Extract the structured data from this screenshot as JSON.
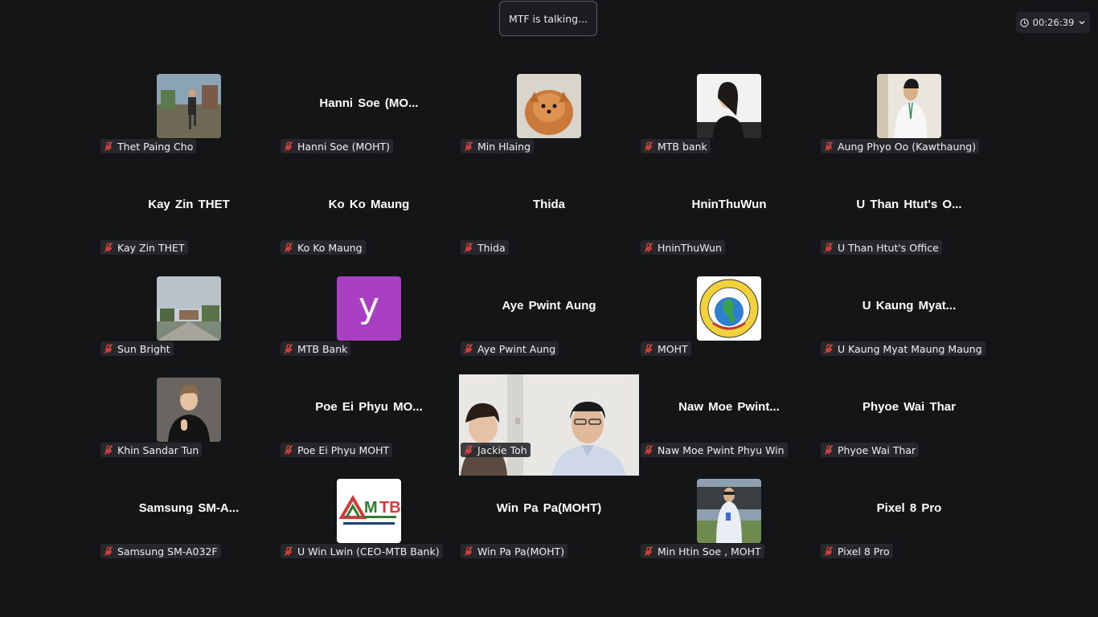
{
  "talking_indicator": "MTF is talking...",
  "timer": "00:26:39",
  "colors": {
    "background": "#141517",
    "mic_muted": "#e2453c"
  },
  "participants": [
    {
      "name": "Thet Paing Cho",
      "display": "photo",
      "icon": "person-photo"
    },
    {
      "name": "Hanni Soe (MOHT)",
      "display": "name",
      "big_name": "Hanni Soe (MO..."
    },
    {
      "name": "Min Hlaing",
      "display": "photo",
      "icon": "dog-photo"
    },
    {
      "name": "MTB bank",
      "display": "photo",
      "icon": "person-photo"
    },
    {
      "name": "Aung Phyo Oo (Kawthaung)",
      "display": "photo",
      "icon": "person-photo"
    },
    {
      "name": "Kay Zin THET",
      "display": "name",
      "big_name": "Kay Zin THET"
    },
    {
      "name": "Ko Ko Maung",
      "display": "name",
      "big_name": "Ko Ko Maung"
    },
    {
      "name": "Thida",
      "display": "name",
      "big_name": "Thida"
    },
    {
      "name": "HninThuWun",
      "display": "name",
      "big_name": "HninThuWun"
    },
    {
      "name": "U Than Htut's Office",
      "display": "name",
      "big_name": "U Than Htut's O..."
    },
    {
      "name": "Sun Bright",
      "display": "photo",
      "icon": "landscape-photo"
    },
    {
      "name": "MTB Bank",
      "display": "letter",
      "letter": "y",
      "color": "#a93fc1"
    },
    {
      "name": "Aye Pwint Aung",
      "display": "name",
      "big_name": "Aye Pwint Aung"
    },
    {
      "name": "MOHT",
      "display": "photo",
      "icon": "ministry-logo"
    },
    {
      "name": "U Kaung Myat Maung Maung",
      "display": "name",
      "big_name": "U Kaung Myat..."
    },
    {
      "name": "Khin Sandar Tun",
      "display": "photo",
      "icon": "person-photo"
    },
    {
      "name": "Poe Ei Phyu MOHT",
      "display": "name",
      "big_name": "Poe Ei Phyu MO..."
    },
    {
      "name": "Jackie Toh",
      "display": "video",
      "icon": "video-feed"
    },
    {
      "name": "Naw Moe Pwint Phyu Win",
      "display": "name",
      "big_name": "Naw Moe Pwint..."
    },
    {
      "name": "Phyoe Wai Thar",
      "display": "name",
      "big_name": "Phyoe Wai Thar"
    },
    {
      "name": "Samsung SM-A032F",
      "display": "name",
      "big_name": "Samsung SM-A..."
    },
    {
      "name": "U Win Lwin (CEO-MTB Bank)",
      "display": "photo",
      "icon": "mtb-logo"
    },
    {
      "name": "Win Pa Pa(MOHT)",
      "display": "name",
      "big_name": "Win Pa Pa(MOHT)"
    },
    {
      "name": "Min Htin Soe , MOHT",
      "display": "photo",
      "icon": "person-photo"
    },
    {
      "name": "Pixel 8 Pro",
      "display": "name",
      "big_name": "Pixel 8 Pro"
    }
  ]
}
